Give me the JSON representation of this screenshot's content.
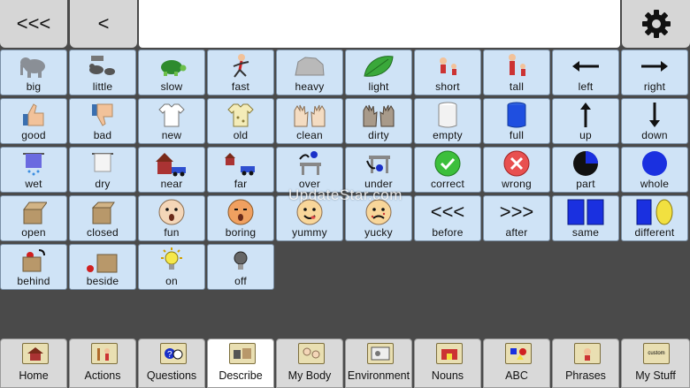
{
  "topbar": {
    "back_all_label": "<<<",
    "back_label": "<",
    "settings_icon": "gear-icon"
  },
  "grid": {
    "rows": [
      [
        {
          "label": "big",
          "icon": "elephant-icon"
        },
        {
          "label": "little",
          "icon": "mice-icon"
        },
        {
          "label": "slow",
          "icon": "turtle-icon"
        },
        {
          "label": "fast",
          "icon": "runner-icon"
        },
        {
          "label": "heavy",
          "icon": "rock-icon"
        },
        {
          "label": "light",
          "icon": "leaf-icon"
        },
        {
          "label": "short",
          "icon": "short-people-icon"
        },
        {
          "label": "tall",
          "icon": "tall-people-icon"
        },
        {
          "label": "left",
          "icon": "arrow-left-icon"
        },
        {
          "label": "right",
          "icon": "arrow-right-icon"
        }
      ],
      [
        {
          "label": "good",
          "icon": "thumbs-up-icon"
        },
        {
          "label": "bad",
          "icon": "thumbs-down-icon"
        },
        {
          "label": "new",
          "icon": "clean-shirt-icon"
        },
        {
          "label": "old",
          "icon": "old-shirt-icon"
        },
        {
          "label": "clean",
          "icon": "clean-hands-icon"
        },
        {
          "label": "dirty",
          "icon": "dirty-hands-icon"
        },
        {
          "label": "empty",
          "icon": "empty-cup-icon"
        },
        {
          "label": "full",
          "icon": "full-cup-icon"
        },
        {
          "label": "up",
          "icon": "arrow-up-icon"
        },
        {
          "label": "down",
          "icon": "arrow-down-icon"
        }
      ],
      [
        {
          "label": "wet",
          "icon": "wet-towel-icon"
        },
        {
          "label": "dry",
          "icon": "dry-towel-icon"
        },
        {
          "label": "near",
          "icon": "house-car-near-icon"
        },
        {
          "label": "far",
          "icon": "house-car-far-icon"
        },
        {
          "label": "over",
          "icon": "ball-over-table-icon"
        },
        {
          "label": "under",
          "icon": "ball-under-table-icon"
        },
        {
          "label": "correct",
          "icon": "check-circle-icon"
        },
        {
          "label": "wrong",
          "icon": "x-circle-icon"
        },
        {
          "label": "part",
          "icon": "part-circle-icon"
        },
        {
          "label": "whole",
          "icon": "whole-circle-icon"
        }
      ],
      [
        {
          "label": "open",
          "icon": "open-box-icon"
        },
        {
          "label": "closed",
          "icon": "closed-box-icon"
        },
        {
          "label": "fun",
          "icon": "happy-face-icon"
        },
        {
          "label": "boring",
          "icon": "bored-face-icon"
        },
        {
          "label": "yummy",
          "icon": "yummy-face-icon"
        },
        {
          "label": "yucky",
          "icon": "yucky-face-icon"
        },
        {
          "label": "before",
          "icon": "before-arrows-icon",
          "glyph": "<<<"
        },
        {
          "label": "after",
          "icon": "after-arrows-icon",
          "glyph": ">>>"
        },
        {
          "label": "same",
          "icon": "same-squares-icon"
        },
        {
          "label": "different",
          "icon": "different-shapes-icon"
        }
      ],
      [
        {
          "label": "behind",
          "icon": "behind-box-icon"
        },
        {
          "label": "beside",
          "icon": "beside-box-icon"
        },
        {
          "label": "on",
          "icon": "lightbulb-on-icon"
        },
        {
          "label": "off",
          "icon": "lightbulb-off-icon"
        }
      ]
    ]
  },
  "bottom_tabs": [
    {
      "label": "Home",
      "icon": "house-icon",
      "active": false
    },
    {
      "label": "Actions",
      "icon": "actions-icon",
      "active": false
    },
    {
      "label": "Questions",
      "icon": "questions-icon",
      "active": false
    },
    {
      "label": "Describe",
      "icon": "describe-icon",
      "active": true
    },
    {
      "label": "My Body",
      "icon": "body-icon",
      "active": false
    },
    {
      "label": "Environment",
      "icon": "environment-icon",
      "active": false
    },
    {
      "label": "Nouns",
      "icon": "nouns-icon",
      "active": false
    },
    {
      "label": "ABC",
      "icon": "abc-icon",
      "active": false
    },
    {
      "label": "Phrases",
      "icon": "phrases-icon",
      "active": false
    },
    {
      "label": "My Stuff",
      "icon": "custom-folder-icon",
      "icon_text": "custom",
      "active": false
    }
  ],
  "watermark": "UpdateStar.com",
  "colors": {
    "cell_bg": "#cfe3f6",
    "background": "#4a4a4a",
    "tab_bg": "#d9d9d9",
    "tab_active_bg": "#ffffff"
  }
}
